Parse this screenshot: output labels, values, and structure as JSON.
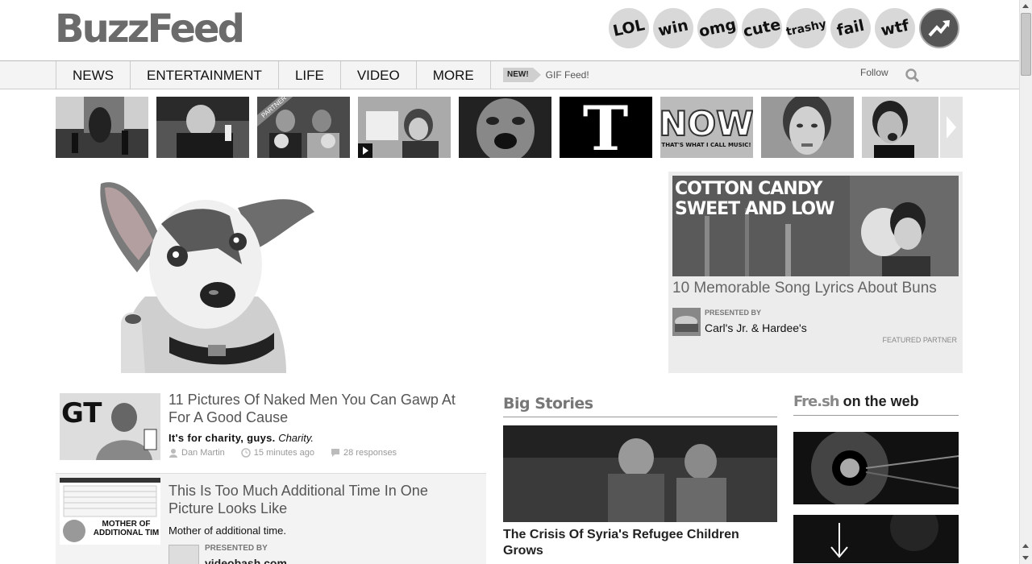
{
  "header": {
    "logo": "BuzzFeed",
    "badges": [
      {
        "label": "LOL",
        "icon": "lol-badge-icon"
      },
      {
        "label": "win",
        "icon": "win-badge-icon"
      },
      {
        "label": "omg",
        "icon": "omg-badge-icon"
      },
      {
        "label": "cute",
        "icon": "cute-badge-icon"
      },
      {
        "label": "trashy",
        "icon": "trashy-badge-icon"
      },
      {
        "label": "fail",
        "icon": "fail-badge-icon"
      },
      {
        "label": "wtf",
        "icon": "wtf-badge-icon"
      },
      {
        "label": "",
        "icon": "trending-arrow-icon"
      }
    ]
  },
  "nav": {
    "items": [
      "NEWS",
      "ENTERTAINMENT",
      "LIFE",
      "VIDEO",
      "MORE"
    ],
    "new_label": "NEW!",
    "gif_feed": "GIF Feed!",
    "follow": "Follow",
    "search_icon": "search-icon"
  },
  "strip": {
    "partner_tag": "PARTNER",
    "thumbs": [
      {
        "name": "thumb-statue-photo"
      },
      {
        "name": "thumb-bar-photo"
      },
      {
        "name": "thumb-partner-photo"
      },
      {
        "name": "thumb-certificate-video"
      },
      {
        "name": "thumb-face-photo"
      },
      {
        "name": "thumb-nyt-logo"
      },
      {
        "name": "thumb-now-album"
      },
      {
        "name": "thumb-actress-photo"
      },
      {
        "name": "thumb-screaming-photo"
      }
    ],
    "nyt_letter": "T",
    "now_text": "NOW",
    "now_sub": "THAT'S WHAT I CALL MUSIC!"
  },
  "featured": {
    "overlay_line1": "COTTON CANDY",
    "overlay_line2": "SWEET AND LOW",
    "title": "10 Memorable Song Lyrics About Buns",
    "presented_by": "PRESENTED BY",
    "sponsor": "Carl's Jr. & Hardee's",
    "featured_partner": "FEATURED PARTNER"
  },
  "articles": [
    {
      "thumb_text": "GT",
      "title": "11 Pictures Of Naked Men You Can Gawp At For A Good Cause",
      "sub_bold": "It's for charity, guys.",
      "sub_italic": "Charity.",
      "author": "Dan Martin",
      "time": "15 minutes ago",
      "responses": "28 responses"
    },
    {
      "thumb_text": "MOTHER OF ADDITIONAL TIM",
      "title": "This Is Too Much Additional Time In One Picture Looks Like",
      "sub": "Mother of additional time.",
      "presented_by": "PRESENTED BY",
      "sponsor": "videobash.com"
    }
  ],
  "big_stories": {
    "heading": "Big Stories",
    "title": "The Crisis Of Syria's Refugee Children Grows"
  },
  "fresh": {
    "logo": "Fre.sh",
    "title": "on the web"
  }
}
